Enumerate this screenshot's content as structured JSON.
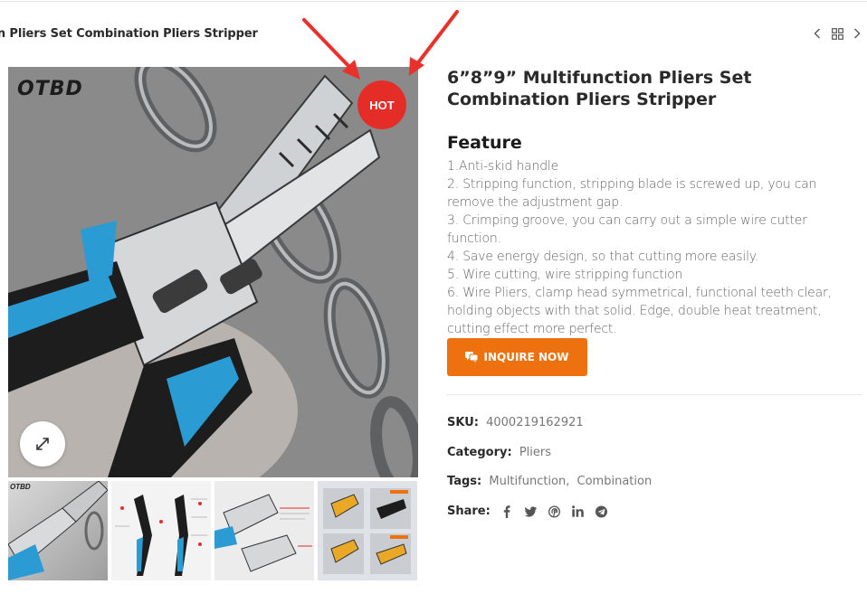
{
  "header": {
    "breadcrumb_title": "on Pliers Set Combination Pliers Stripper",
    "nav": {
      "prev_icon": "chevron-left-icon",
      "grid_icon": "grid-icon",
      "next_icon": "chevron-right-icon"
    }
  },
  "gallery": {
    "brand_logo": "OTBD",
    "badge": "HOT",
    "zoom_icon": "expand-icon",
    "thumbnails": [
      {
        "logo": "OTBD"
      },
      {
        "logo": ""
      },
      {
        "logo": ""
      },
      {
        "logo": ""
      }
    ]
  },
  "product": {
    "title": "6”8”9” Multifunction Pliers Set Combination Pliers Stripper",
    "feature_heading": "Feature",
    "features": [
      "1.Anti-skid handle",
      "2. Stripping function, stripping blade is screwed up, you can remove the adjustment gap.",
      "3. Crimping groove, you can carry out a simple wire cutter function.",
      "4. Save energy design, so that cutting more easily.",
      "5. Wire cutting, wire stripping function",
      "6. Wire Pliers, clamp head symmetrical, functional teeth clear, holding objects with that solid. Edge, double heat treatment, cutting effect more perfect."
    ],
    "inquire_label": "INQUIRE NOW",
    "sku_label": "SKU:",
    "sku_value": "4000219162921",
    "category_label": "Category:",
    "category_value": "Pliers",
    "tags_label": "Tags:",
    "tags": [
      "Multifunction",
      "Combination"
    ],
    "tags_separator": ",",
    "share_label": "Share:",
    "share_icons": [
      "facebook-icon",
      "twitter-icon",
      "pinterest-icon",
      "linkedin-icon",
      "telegram-icon"
    ]
  },
  "colors": {
    "accent": "#ee7110",
    "hot_badge": "#e52d27",
    "annotation_arrow": "#e8312a"
  }
}
